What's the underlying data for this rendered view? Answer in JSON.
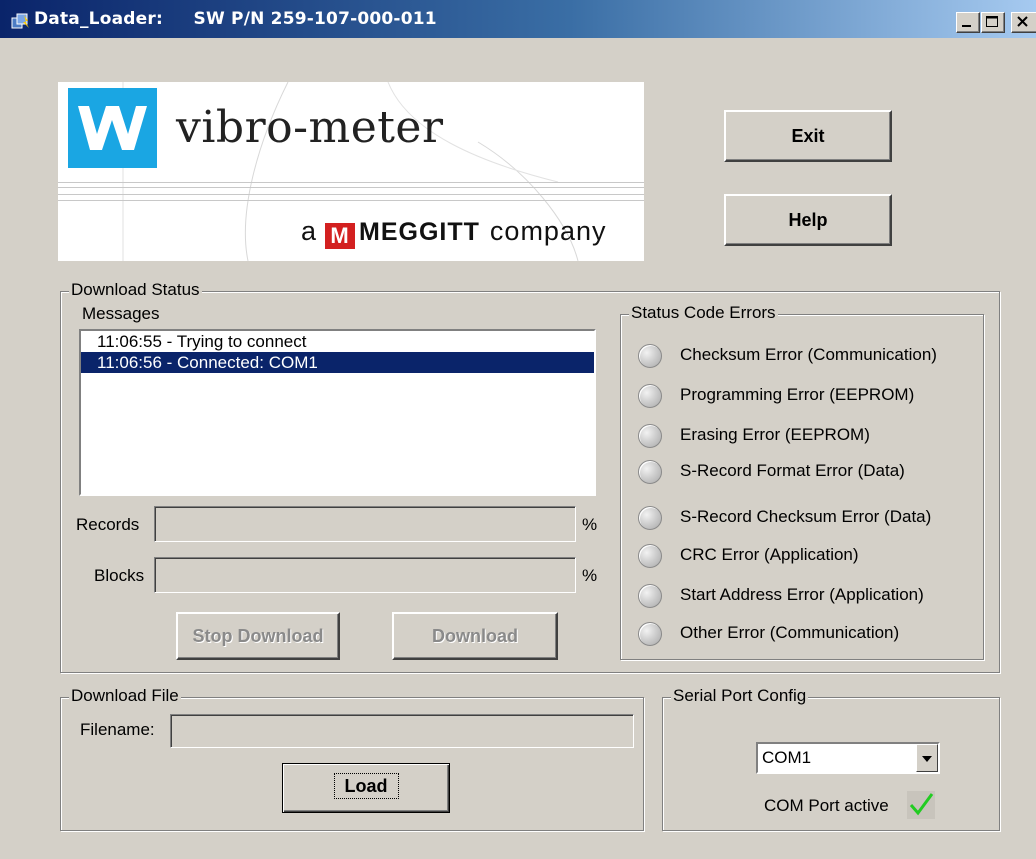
{
  "window": {
    "title": "Data_Loader:     SW P/N 259-107-000-011",
    "icons": {
      "app": "app-icon",
      "minimize": "minimize-icon",
      "maximize": "maximize-icon",
      "close": "close-icon"
    }
  },
  "logo": {
    "brand_mark": "WM",
    "brand_name": "vibro-meter",
    "company_prefix": "a",
    "meggitt_mark": "M",
    "meggitt_name": "MEGGITT",
    "company_suffix": "company"
  },
  "buttons": {
    "exit": "Exit",
    "help": "Help",
    "stop_download": "Stop Download",
    "download": "Download",
    "load": "Load"
  },
  "download_status": {
    "title": "Download Status",
    "messages_label": "Messages",
    "messages": [
      {
        "text": "11:06:55 - Trying to connect",
        "selected": false
      },
      {
        "text": "11:06:56 - Connected: COM1",
        "selected": true
      }
    ],
    "records_label": "Records",
    "records_value": "",
    "blocks_label": "Blocks",
    "blocks_value": "",
    "percent_symbol": "%"
  },
  "status_code_errors": {
    "title": "Status Code Errors",
    "items": [
      "Checksum Error (Communication)",
      "Programming Error (EEPROM)",
      "Erasing Error (EEPROM)",
      "S-Record Format Error (Data)",
      "S-Record Checksum Error (Data)",
      "CRC Error (Application)",
      "Start Address Error (Application)",
      "Other Error (Communication)"
    ]
  },
  "download_file": {
    "title": "Download File",
    "filename_label": "Filename:",
    "filename_value": ""
  },
  "serial_port": {
    "title": "Serial Port Config",
    "selected_port": "COM1",
    "active_label": "COM Port active",
    "active_icon": "checkmark-icon"
  },
  "colors": {
    "title_bar_start": "#0a246a",
    "selection": "#0a246a",
    "brand_blue": "#1aa6e3",
    "meggitt_red": "#d32020",
    "check_green": "#22cc22"
  }
}
